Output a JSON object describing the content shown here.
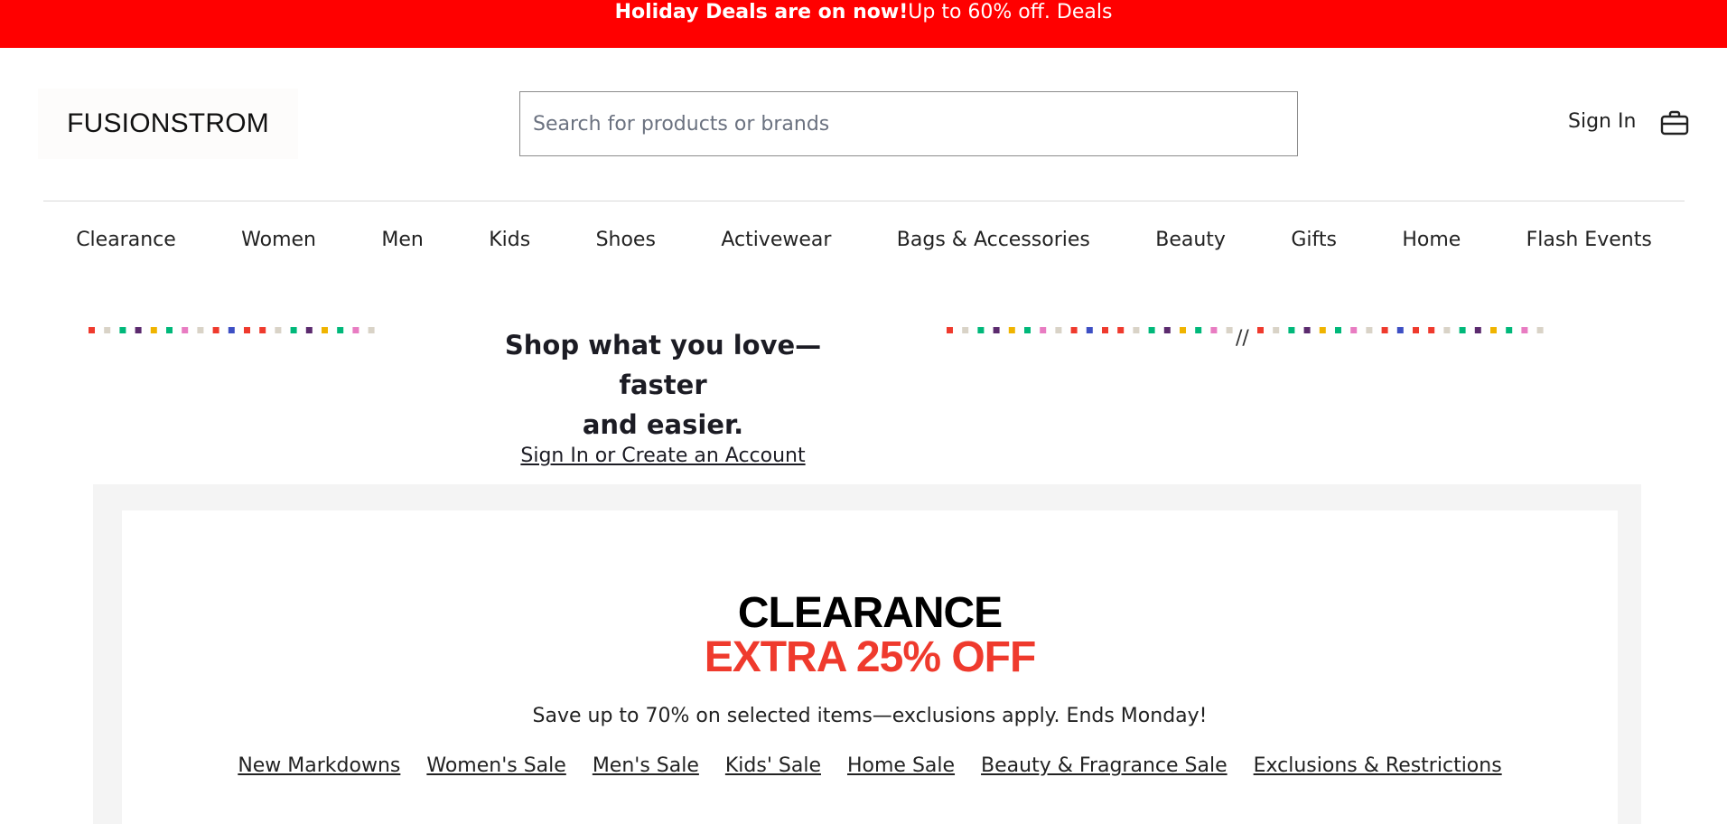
{
  "promo_bar": {
    "bold": "Holiday Deals are on now!",
    "text": "Up to 60% off. Deals",
    "bg_color": "#ff0000"
  },
  "header": {
    "logo": "FUSIONSTROM",
    "search_placeholder": "Search for products or brands",
    "sign_in": "Sign In",
    "bag_icon": "shopping-bag-icon"
  },
  "nav": {
    "items": [
      "Clearance",
      "Women",
      "Men",
      "Kids",
      "Shoes",
      "Activewear",
      "Bags & Accessories",
      "Beauty",
      "Gifts",
      "Home",
      "Flash Events"
    ]
  },
  "signin_banner": {
    "heading_line1": "Shop what you love—faster",
    "heading_line2": "and easier.",
    "link": "Sign In or Create an Account",
    "slashes": "//"
  },
  "promo": {
    "title": "CLEARANCE",
    "subtitle": "EXTRA 25% OFF",
    "text": "Save up to 70% on selected items—exclusions apply. Ends Monday!",
    "links": [
      "New Markdowns",
      "Women's Sale",
      "Men's Sale",
      "Kids' Sale",
      "Home Sale",
      "Beauty & Fragrance Sale",
      "Exclusions & Restrictions"
    ],
    "accent_color": "#ef3a2d"
  },
  "dot_colors": [
    "#ef3a2d",
    "#d9d3c7",
    "#00b87a",
    "#5b2a6e",
    "#f0b400",
    "#00b87a",
    "#e87cc2",
    "#d9d3c7",
    "#ef3a2d",
    "#3d4fc4",
    "#ef3a2d"
  ]
}
